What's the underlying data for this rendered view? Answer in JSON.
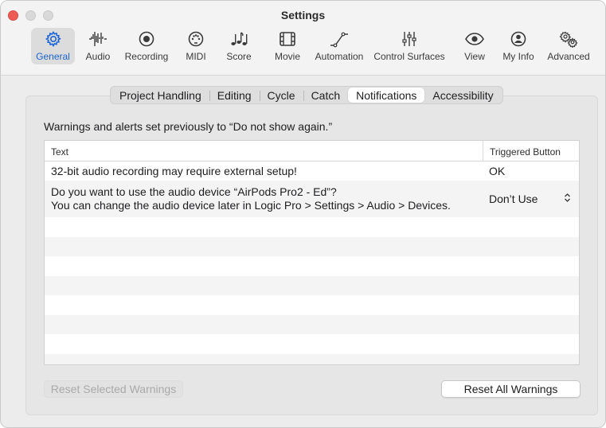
{
  "window": {
    "title": "Settings"
  },
  "toolbar": {
    "items": [
      {
        "label": "General",
        "icon": "gear-icon",
        "active": true
      },
      {
        "label": "Audio",
        "icon": "waveform-icon"
      },
      {
        "label": "Recording",
        "icon": "record-icon"
      },
      {
        "label": "MIDI",
        "icon": "midi-port-icon"
      },
      {
        "label": "Score",
        "icon": "music-notes-icon"
      },
      {
        "label": "Movie",
        "icon": "film-icon"
      },
      {
        "label": "Automation",
        "icon": "automation-curve-icon"
      },
      {
        "label": "Control Surfaces",
        "icon": "sliders-icon"
      },
      {
        "label": "View",
        "icon": "eye-icon"
      },
      {
        "label": "My Info",
        "icon": "person-icon"
      },
      {
        "label": "Advanced",
        "icon": "gears-icon"
      }
    ]
  },
  "tabs": {
    "items": [
      {
        "label": "Project Handling"
      },
      {
        "label": "Editing"
      },
      {
        "label": "Cycle"
      },
      {
        "label": "Catch"
      },
      {
        "label": "Notifications",
        "active": true
      },
      {
        "label": "Accessibility"
      }
    ]
  },
  "content": {
    "heading": "Warnings and alerts set previously to “Do not show again.”",
    "table": {
      "columns": [
        "Text",
        "Triggered Button"
      ],
      "rows": [
        {
          "text_line1": "32-bit audio recording may require external setup!",
          "text_line2": "",
          "button": "OK"
        },
        {
          "text_line1": "Do you want to use the audio device “AirPods Pro2 - Ed”?",
          "text_line2": "You can change the audio device later in Logic Pro > Settings > Audio > Devices.",
          "button": "Don’t Use"
        }
      ]
    },
    "buttons": {
      "reset_selected": "Reset Selected Warnings",
      "reset_all": "Reset All Warnings"
    }
  },
  "colors": {
    "accent": "#1b64d6",
    "close": "#ee5b55"
  }
}
